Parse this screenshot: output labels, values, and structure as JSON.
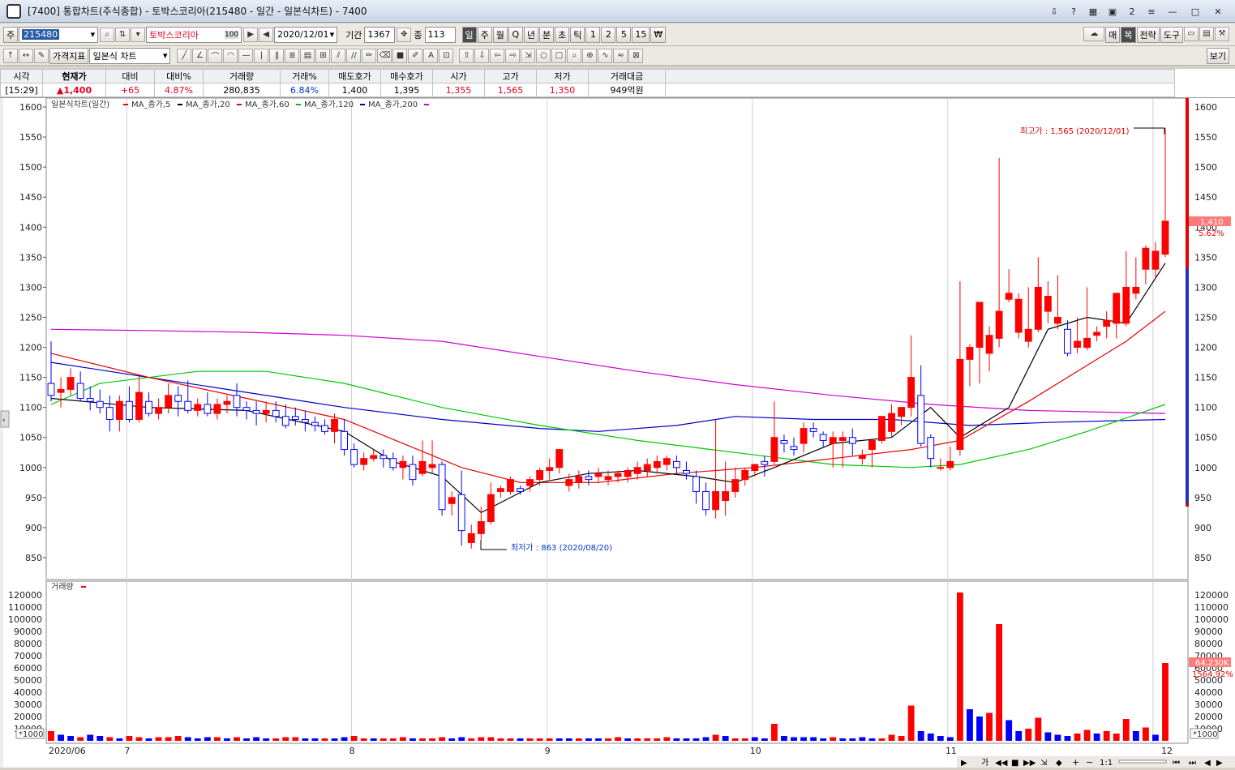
{
  "window": {
    "title": "[7400] 통합차트(주식종합) - 토박스코리아(215480 - 일간 - 일본식차트) - 7400",
    "title_buttons": [
      "?",
      "?",
      "?",
      "2"
    ]
  },
  "toolbar1": {
    "market_label": "주",
    "code": "215480",
    "stock_name": "토박스코리아",
    "name_badge": "100",
    "date": "2020/12/01",
    "period_label": "기간",
    "period_value": "1367",
    "count_label": "종",
    "count_value": "113",
    "period_buttons": [
      "일",
      "주",
      "월",
      "Q",
      "년",
      "분",
      "초",
      "틱",
      "1",
      "2",
      "5",
      "15",
      "₩"
    ],
    "right_buttons": [
      "매",
      "복",
      "전략",
      "도구"
    ]
  },
  "toolbar2": {
    "indicator_label": "가격지표",
    "chart_type": "일본식 차트",
    "view_button": "보기"
  },
  "info": {
    "headers": [
      "시각",
      "현재가",
      "대비",
      "대비%",
      "거래량",
      "거래%",
      "매도호가",
      "매수호가",
      "시가",
      "고가",
      "저가",
      "거래대금"
    ],
    "values": [
      "[15:29]",
      "▲1,400",
      "+65",
      "4.87%",
      "280,835",
      "6.84%",
      "1,400",
      "1,395",
      "1,355",
      "1,565",
      "1,350",
      "949억원"
    ]
  },
  "legend": {
    "items": [
      {
        "label": "일본식차트(일간)",
        "color": "#e60000"
      },
      {
        "label": "MA_종가,5",
        "color": "#000000"
      },
      {
        "label": "MA_종가,20",
        "color": "#e60000"
      },
      {
        "label": "MA_종가,60",
        "color": "#00c000"
      },
      {
        "label": "MA_종가,120",
        "color": "#0000c8"
      },
      {
        "label": "MA_종가,200",
        "color": "#d000d0"
      }
    ]
  },
  "volume_legend": "거래량",
  "annotations": {
    "high": "최고가 : 1,565 (2020/12/01)",
    "low": "최저가 : 863 (2020/08/20)",
    "price_tag": "1,410",
    "price_pct": "5.62%",
    "volume_tag": "64,230K",
    "volume_pct": "1564.92%",
    "volume_unit": "*1000"
  },
  "colors": {
    "up": "#ff0000",
    "down": "#0000ff",
    "downFill": "#ffffff",
    "ma5": "#000000",
    "ma20": "#e60000",
    "ma60": "#00c800",
    "ma120": "#0000c8",
    "ma200": "#d000d0"
  },
  "chart_data": {
    "type": "candlestick",
    "price_axis": {
      "ylim": [
        810,
        1610
      ],
      "ticks": [
        850,
        900,
        950,
        1000,
        1050,
        1100,
        1150,
        1200,
        1250,
        1300,
        1350,
        1400,
        1450,
        1500,
        1550,
        1600
      ]
    },
    "volume_axis": {
      "ylim": [
        0,
        125000
      ],
      "ticks": [
        10000,
        20000,
        30000,
        40000,
        50000,
        60000,
        70000,
        80000,
        90000,
        100000,
        110000,
        120000
      ],
      "unit": "*1000"
    },
    "x_labels": [
      "2020/06",
      "7",
      "8",
      "9",
      "10",
      "11",
      "12"
    ],
    "x_label_index": [
      0,
      8,
      31,
      51,
      72,
      92,
      113
    ],
    "candles": [
      [
        1140,
        1210,
        1110,
        1120
      ],
      [
        1125,
        1150,
        1100,
        1130
      ],
      [
        1130,
        1165,
        1120,
        1150
      ],
      [
        1140,
        1160,
        1110,
        1115
      ],
      [
        1115,
        1135,
        1095,
        1110
      ],
      [
        1110,
        1130,
        1090,
        1100
      ],
      [
        1100,
        1120,
        1060,
        1080
      ],
      [
        1080,
        1120,
        1060,
        1110
      ],
      [
        1110,
        1135,
        1075,
        1080
      ],
      [
        1080,
        1155,
        1075,
        1125
      ],
      [
        1110,
        1125,
        1085,
        1090
      ],
      [
        1090,
        1115,
        1080,
        1100
      ],
      [
        1100,
        1140,
        1090,
        1120
      ],
      [
        1120,
        1135,
        1085,
        1110
      ],
      [
        1110,
        1145,
        1090,
        1095
      ],
      [
        1095,
        1115,
        1085,
        1105
      ],
      [
        1105,
        1125,
        1085,
        1090
      ],
      [
        1090,
        1115,
        1080,
        1105
      ],
      [
        1105,
        1120,
        1090,
        1110
      ],
      [
        1120,
        1140,
        1085,
        1100
      ],
      [
        1100,
        1110,
        1080,
        1095
      ],
      [
        1095,
        1110,
        1070,
        1090
      ],
      [
        1090,
        1110,
        1075,
        1095
      ],
      [
        1095,
        1110,
        1075,
        1085
      ],
      [
        1085,
        1105,
        1065,
        1070
      ],
      [
        1085,
        1100,
        1070,
        1080
      ],
      [
        1080,
        1095,
        1060,
        1075
      ],
      [
        1075,
        1085,
        1060,
        1070
      ],
      [
        1070,
        1080,
        1055,
        1060
      ],
      [
        1060,
        1090,
        1040,
        1080
      ],
      [
        1060,
        1080,
        1020,
        1030
      ],
      [
        1030,
        1040,
        1000,
        1005
      ],
      [
        1005,
        1025,
        995,
        1015
      ],
      [
        1015,
        1030,
        1010,
        1020
      ],
      [
        1020,
        1030,
        1000,
        1015
      ],
      [
        1015,
        1025,
        995,
        1000
      ],
      [
        1000,
        1020,
        980,
        1010
      ],
      [
        1005,
        1020,
        970,
        980
      ],
      [
        990,
        1045,
        985,
        1010
      ],
      [
        1000,
        1045,
        990,
        1005
      ],
      [
        1005,
        1010,
        920,
        930
      ],
      [
        940,
        960,
        920,
        950
      ],
      [
        955,
        995,
        870,
        895
      ],
      [
        875,
        905,
        865,
        890
      ],
      [
        890,
        935,
        880,
        910
      ],
      [
        910,
        975,
        905,
        955
      ],
      [
        960,
        970,
        950,
        965
      ],
      [
        960,
        985,
        955,
        980
      ],
      [
        965,
        970,
        955,
        960
      ],
      [
        970,
        985,
        960,
        980
      ],
      [
        980,
        1000,
        970,
        995
      ],
      [
        995,
        1015,
        980,
        1000
      ],
      [
        1000,
        1015,
        990,
        1030
      ],
      [
        970,
        990,
        960,
        980
      ],
      [
        975,
        995,
        965,
        985
      ],
      [
        985,
        995,
        970,
        980
      ],
      [
        985,
        1000,
        975,
        990
      ],
      [
        980,
        995,
        970,
        985
      ],
      [
        985,
        995,
        975,
        990
      ],
      [
        985,
        1000,
        975,
        995
      ],
      [
        990,
        1010,
        980,
        1000
      ],
      [
        995,
        1015,
        985,
        1005
      ],
      [
        1000,
        1020,
        990,
        1010
      ],
      [
        1005,
        1020,
        995,
        1015
      ],
      [
        1010,
        1020,
        990,
        1000
      ],
      [
        995,
        1010,
        980,
        990
      ],
      [
        985,
        995,
        940,
        960
      ],
      [
        960,
        975,
        920,
        930
      ],
      [
        930,
        1080,
        915,
        960
      ],
      [
        945,
        1010,
        920,
        960
      ],
      [
        960,
        1000,
        950,
        980
      ],
      [
        980,
        1000,
        970,
        995
      ],
      [
        995,
        1005,
        985,
        1005
      ],
      [
        1010,
        1020,
        985,
        1005
      ],
      [
        1010,
        1110,
        1005,
        1050
      ],
      [
        1045,
        1055,
        1025,
        1040
      ],
      [
        1035,
        1050,
        1020,
        1030
      ],
      [
        1040,
        1075,
        1025,
        1065
      ],
      [
        1065,
        1075,
        1050,
        1060
      ],
      [
        1055,
        1060,
        1035,
        1045
      ],
      [
        1040,
        1060,
        1000,
        1050
      ],
      [
        1045,
        1060,
        1000,
        1050
      ],
      [
        1050,
        1065,
        1020,
        1040
      ],
      [
        1015,
        1030,
        1005,
        1020
      ],
      [
        1030,
        1045,
        1000,
        1045
      ],
      [
        1045,
        1080,
        1040,
        1085
      ],
      [
        1060,
        1105,
        1050,
        1090
      ],
      [
        1085,
        1100,
        1070,
        1100
      ],
      [
        1100,
        1220,
        1085,
        1150
      ],
      [
        1120,
        1170,
        1035,
        1040
      ],
      [
        1050,
        1055,
        1000,
        1015
      ],
      [
        1000,
        1015,
        995,
        1000
      ],
      [
        1000,
        1035,
        995,
        1010
      ],
      [
        1030,
        1310,
        1020,
        1180
      ],
      [
        1180,
        1205,
        1135,
        1200
      ],
      [
        1200,
        1265,
        1140,
        1275
      ],
      [
        1190,
        1235,
        1160,
        1220
      ],
      [
        1215,
        1515,
        1200,
        1260
      ],
      [
        1280,
        1330,
        1275,
        1290
      ],
      [
        1225,
        1290,
        1215,
        1280
      ],
      [
        1210,
        1300,
        1200,
        1230
      ],
      [
        1230,
        1350,
        1225,
        1300
      ],
      [
        1260,
        1310,
        1240,
        1285
      ],
      [
        1240,
        1320,
        1230,
        1250
      ],
      [
        1230,
        1245,
        1185,
        1190
      ],
      [
        1200,
        1250,
        1190,
        1210
      ],
      [
        1200,
        1300,
        1195,
        1215
      ],
      [
        1220,
        1235,
        1210,
        1225
      ],
      [
        1235,
        1260,
        1215,
        1245
      ],
      [
        1240,
        1290,
        1215,
        1290
      ],
      [
        1240,
        1360,
        1235,
        1300
      ],
      [
        1290,
        1350,
        1280,
        1300
      ],
      [
        1330,
        1370,
        1305,
        1365
      ],
      [
        1330,
        1375,
        1315,
        1360
      ],
      [
        1355,
        1565,
        1350,
        1410
      ]
    ],
    "volumes": [
      [
        8,
        1
      ],
      [
        5,
        0
      ],
      [
        4,
        0
      ],
      [
        3,
        1
      ],
      [
        5,
        0
      ],
      [
        4,
        0
      ],
      [
        3,
        1
      ],
      [
        2,
        0
      ],
      [
        4,
        1
      ],
      [
        3,
        1
      ],
      [
        2,
        0
      ],
      [
        3,
        1
      ],
      [
        3,
        1
      ],
      [
        4,
        1
      ],
      [
        3,
        0
      ],
      [
        2,
        0
      ],
      [
        3,
        0
      ],
      [
        3,
        1
      ],
      [
        2,
        0
      ],
      [
        3,
        1
      ],
      [
        2,
        0
      ],
      [
        3,
        0
      ],
      [
        2,
        0
      ],
      [
        2,
        1
      ],
      [
        3,
        1
      ],
      [
        3,
        1
      ],
      [
        2,
        0
      ],
      [
        2,
        0
      ],
      [
        2,
        1
      ],
      [
        2,
        0
      ],
      [
        3,
        0
      ],
      [
        4,
        1
      ],
      [
        2,
        1
      ],
      [
        2,
        0
      ],
      [
        2,
        1
      ],
      [
        2,
        1
      ],
      [
        3,
        1
      ],
      [
        2,
        0
      ],
      [
        2,
        1
      ],
      [
        2,
        1
      ],
      [
        3,
        1
      ],
      [
        2,
        0
      ],
      [
        3,
        0
      ],
      [
        2,
        1
      ],
      [
        3,
        1
      ],
      [
        3,
        1
      ],
      [
        2,
        1
      ],
      [
        2,
        1
      ],
      [
        2,
        0
      ],
      [
        2,
        1
      ],
      [
        2,
        1
      ],
      [
        2,
        1
      ],
      [
        2,
        0
      ],
      [
        2,
        0
      ],
      [
        2,
        1
      ],
      [
        2,
        0
      ],
      [
        2,
        0
      ],
      [
        2,
        1
      ],
      [
        3,
        1
      ],
      [
        2,
        0
      ],
      [
        2,
        1
      ],
      [
        2,
        1
      ],
      [
        2,
        1
      ],
      [
        3,
        1
      ],
      [
        2,
        0
      ],
      [
        2,
        0
      ],
      [
        2,
        0
      ],
      [
        3,
        0
      ],
      [
        5,
        1
      ],
      [
        4,
        0
      ],
      [
        2,
        1
      ],
      [
        2,
        1
      ],
      [
        3,
        0
      ],
      [
        2,
        0
      ],
      [
        14,
        1
      ],
      [
        4,
        0
      ],
      [
        3,
        0
      ],
      [
        3,
        0
      ],
      [
        3,
        0
      ],
      [
        2,
        0
      ],
      [
        3,
        1
      ],
      [
        2,
        0
      ],
      [
        2,
        0
      ],
      [
        3,
        0
      ],
      [
        2,
        0
      ],
      [
        2,
        1
      ],
      [
        5,
        1
      ],
      [
        4,
        1
      ],
      [
        29,
        1
      ],
      [
        8,
        0
      ],
      [
        6,
        0
      ],
      [
        4,
        0
      ],
      [
        3,
        0
      ],
      [
        122,
        1
      ],
      [
        26,
        0
      ],
      [
        20,
        0
      ],
      [
        23,
        1
      ],
      [
        96,
        1
      ],
      [
        17,
        0
      ],
      [
        8,
        0
      ],
      [
        10,
        1
      ],
      [
        19,
        1
      ],
      [
        7,
        0
      ],
      [
        5,
        0
      ],
      [
        4,
        0
      ],
      [
        6,
        1
      ],
      [
        9,
        1
      ],
      [
        6,
        0
      ],
      [
        8,
        1
      ],
      [
        6,
        1
      ],
      [
        18,
        1
      ],
      [
        8,
        0
      ],
      [
        11,
        1
      ],
      [
        5,
        0
      ],
      [
        64,
        1
      ]
    ],
    "ma": {
      "ma5": [
        [
          0,
          1115
        ],
        [
          10,
          1100
        ],
        [
          20,
          1095
        ],
        [
          30,
          1060
        ],
        [
          35,
          1010
        ],
        [
          40,
          985
        ],
        [
          44,
          925
        ],
        [
          50,
          975
        ],
        [
          55,
          990
        ],
        [
          60,
          995
        ],
        [
          66,
          985
        ],
        [
          70,
          975
        ],
        [
          74,
          1000
        ],
        [
          80,
          1040
        ],
        [
          86,
          1050
        ],
        [
          90,
          1100
        ],
        [
          93,
          1050
        ],
        [
          98,
          1100
        ],
        [
          102,
          1230
        ],
        [
          106,
          1250
        ],
        [
          110,
          1240
        ],
        [
          114,
          1340
        ]
      ],
      "ma20": [
        [
          0,
          1190
        ],
        [
          10,
          1150
        ],
        [
          20,
          1115
        ],
        [
          30,
          1080
        ],
        [
          36,
          1040
        ],
        [
          42,
          1000
        ],
        [
          48,
          975
        ],
        [
          56,
          975
        ],
        [
          64,
          990
        ],
        [
          72,
          1000
        ],
        [
          80,
          1015
        ],
        [
          88,
          1030
        ],
        [
          93,
          1045
        ],
        [
          100,
          1110
        ],
        [
          106,
          1170
        ],
        [
          110,
          1210
        ],
        [
          114,
          1260
        ]
      ],
      "ma60": [
        [
          0,
          1105
        ],
        [
          5,
          1140
        ],
        [
          15,
          1160
        ],
        [
          22,
          1160
        ],
        [
          30,
          1140
        ],
        [
          40,
          1100
        ],
        [
          50,
          1070
        ],
        [
          60,
          1045
        ],
        [
          70,
          1025
        ],
        [
          80,
          1005
        ],
        [
          88,
          1000
        ],
        [
          93,
          1005
        ],
        [
          100,
          1030
        ],
        [
          106,
          1060
        ],
        [
          114,
          1105
        ]
      ],
      "ma120": [
        [
          0,
          1175
        ],
        [
          10,
          1150
        ],
        [
          20,
          1125
        ],
        [
          30,
          1100
        ],
        [
          40,
          1080
        ],
        [
          50,
          1065
        ],
        [
          56,
          1060
        ],
        [
          64,
          1070
        ],
        [
          70,
          1085
        ],
        [
          78,
          1080
        ],
        [
          86,
          1080
        ],
        [
          94,
          1070
        ],
        [
          102,
          1075
        ],
        [
          114,
          1080
        ]
      ],
      "ma200": [
        [
          0,
          1230
        ],
        [
          10,
          1228
        ],
        [
          20,
          1225
        ],
        [
          30,
          1220
        ],
        [
          40,
          1210
        ],
        [
          50,
          1185
        ],
        [
          60,
          1160
        ],
        [
          70,
          1138
        ],
        [
          80,
          1120
        ],
        [
          90,
          1105
        ],
        [
          100,
          1095
        ],
        [
          114,
          1090
        ]
      ]
    },
    "high": {
      "index": 113,
      "price": 1565
    },
    "low": {
      "index": 43,
      "price": 863
    }
  }
}
